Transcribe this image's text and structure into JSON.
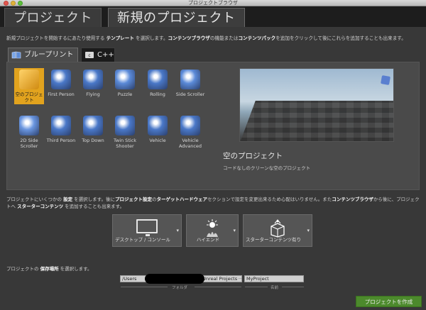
{
  "window": {
    "title": "プロジェクトブラウザ"
  },
  "tabs": [
    {
      "label": "プロジェクト"
    },
    {
      "label": "新規のプロジェクト"
    }
  ],
  "description": {
    "p1": "新規プロジェクトを開始するにあたり使用する ",
    "b1": "テンプレート",
    "p2": " を選択します。",
    "b2": "コンテンツブラウザ",
    "p3": "の機能または",
    "b3": "コンテンツパック",
    "p4": "を追加をクリックして後にこれらを追加することも出来ます。"
  },
  "subtabs": [
    {
      "label": "ブループリント",
      "icon": "blueprint-icon"
    },
    {
      "label": "C++",
      "icon": "cpp-icon"
    }
  ],
  "templates": [
    {
      "label": "空のプロジェクト",
      "icon": "blank-folder-icon",
      "color": "#e2a31e",
      "selected": true
    },
    {
      "label": "First Person",
      "icon": "first-person-icon",
      "color": "#4a78c8"
    },
    {
      "label": "Flying",
      "icon": "flying-icon",
      "color": "#4a78c8"
    },
    {
      "label": "Puzzle",
      "icon": "puzzle-icon",
      "color": "#5b8ad8"
    },
    {
      "label": "Rolling",
      "icon": "rolling-icon",
      "color": "#4a78c8"
    },
    {
      "label": "Side Scroller",
      "icon": "side-scroller-icon",
      "color": "#5b8ad8"
    },
    {
      "label": "2D Side Scroller",
      "icon": "2d-side-scroller-icon",
      "color": "#6a96e0"
    },
    {
      "label": "Third Person",
      "icon": "third-person-icon",
      "color": "#4a78c8"
    },
    {
      "label": "Top Down",
      "icon": "top-down-icon",
      "color": "#4a78c8"
    },
    {
      "label": "Twin Stick Shooter",
      "icon": "twin-stick-icon",
      "color": "#4a78c8"
    },
    {
      "label": "Vehicle",
      "icon": "vehicle-icon",
      "color": "#4a78c8"
    },
    {
      "label": "Vehicle Advanced",
      "icon": "vehicle-advanced-icon",
      "color": "#4a78c8"
    }
  ],
  "selected_template": {
    "name": "空のプロジェクト",
    "description": "コードなしのクリーンな空のプロジェクト"
  },
  "project_settings": {
    "p1": "プロジェクトにいくつかの ",
    "b1": "設定",
    "p2": " を選択します。後に",
    "b2": "プロジェクト設定",
    "p3": "の",
    "b3": "ターゲットハードウェア",
    "p4": "セクションで設定を変更出来るため心配はいりません。また",
    "b4": "コンテンツブラウザ",
    "p5": "から後に、プロジェクトへ ",
    "b5": "スターターコンテンツ",
    "p6": " を追加することも出来ます。"
  },
  "options": [
    {
      "label": "デスクトップ / コンソール",
      "icon": "monitor-icon"
    },
    {
      "label": "ハイエンド",
      "icon": "high-end-icon"
    },
    {
      "label": "スターターコンテンツ有り",
      "icon": "starter-content-icon"
    }
  ],
  "location": {
    "p1": "プロジェクトの ",
    "b1": "保存場所",
    "p2": " を選択します。",
    "folder_prefix": "/Users",
    "folder_suffix": "/Unreal Projects",
    "folder_label": "フォルダ",
    "name_value": "MyProject",
    "name_label": "名前"
  },
  "create_button": "プロジェクトを作成"
}
